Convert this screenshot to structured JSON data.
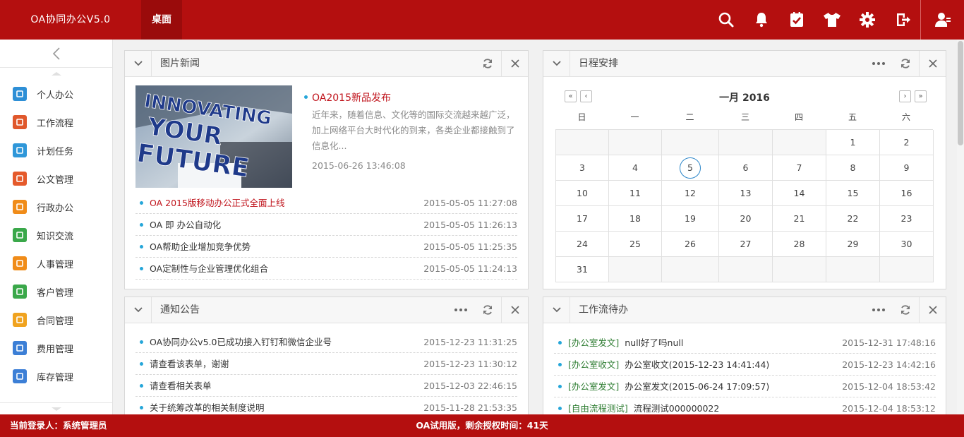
{
  "app": {
    "title": "OA协同办公V5.0",
    "tab": "桌面"
  },
  "top_icons": [
    "search-icon",
    "bell-icon",
    "task-check-icon",
    "shirt-icon",
    "gear-icon",
    "logout-icon"
  ],
  "user_icon": "user-icon",
  "colors": {
    "brand": "#b40f0f",
    "accent_red": "#c0141c",
    "dot_blue": "#25a6d9",
    "tag_green": "#2e7d32"
  },
  "sidebar": {
    "items": [
      {
        "label": "个人办公",
        "icon": "personal-icon",
        "color": "#2e8fd6"
      },
      {
        "label": "工作流程",
        "icon": "workflow-icon",
        "color": "#e0582c"
      },
      {
        "label": "计划任务",
        "icon": "plan-icon",
        "color": "#2f97d9"
      },
      {
        "label": "公文管理",
        "icon": "document-icon",
        "color": "#e55a2b"
      },
      {
        "label": "行政办公",
        "icon": "admin-icon",
        "color": "#f08c19"
      },
      {
        "label": "知识交流",
        "icon": "knowledge-icon",
        "color": "#3aa84a"
      },
      {
        "label": "人事管理",
        "icon": "hr-icon",
        "color": "#f08c19"
      },
      {
        "label": "客户管理",
        "icon": "customer-icon",
        "color": "#3aa84a"
      },
      {
        "label": "合同管理",
        "icon": "contract-icon",
        "color": "#f0a31f"
      },
      {
        "label": "费用管理",
        "icon": "expense-icon",
        "color": "#3c7fd6"
      },
      {
        "label": "库存管理",
        "icon": "inventory-icon",
        "color": "#3c7fd6"
      }
    ]
  },
  "news": {
    "title": "图片新闻",
    "feature": {
      "title": "OA2015新品发布",
      "desc": "近年来，随着信息、文化等的国际交流越来越广泛，加上网络平台大时代化的到来，各类企业都接触到了信息化...",
      "time": "2015-06-26 13:46:08",
      "image_text": [
        "INNOVATING",
        "YOUR",
        "FUTURE"
      ]
    },
    "items": [
      {
        "text": "OA 2015版移动办公正式全面上线",
        "time": "2015-05-05 11:27:08",
        "highlight": true
      },
      {
        "text": "OA 即 办公自动化",
        "time": "2015-05-05 11:26:13",
        "highlight": false
      },
      {
        "text": "OA帮助企业增加竞争优势",
        "time": "2015-05-05 11:25:35",
        "highlight": false
      },
      {
        "text": "OA定制性与企业管理优化组合",
        "time": "2015-05-05 11:24:13",
        "highlight": false
      }
    ]
  },
  "schedule": {
    "title": "日程安排",
    "month_title": "一月 2016",
    "weekdays": [
      "日",
      "一",
      "二",
      "三",
      "四",
      "五",
      "六"
    ],
    "days": [
      "",
      "",
      "",
      "",
      "",
      "1",
      "2",
      "3",
      "4",
      "5",
      "6",
      "7",
      "8",
      "9",
      "10",
      "11",
      "12",
      "13",
      "14",
      "15",
      "16",
      "17",
      "18",
      "19",
      "20",
      "21",
      "22",
      "23",
      "24",
      "25",
      "26",
      "27",
      "28",
      "29",
      "30",
      "31",
      "",
      "",
      "",
      "",
      "",
      ""
    ],
    "today": "5"
  },
  "notice": {
    "title": "通知公告",
    "items": [
      {
        "text": "OA协同办公v5.0已成功接入钉钉和微信企业号",
        "time": "2015-12-23 11:31:25"
      },
      {
        "text": "请查看该表单，谢谢",
        "time": "2015-12-23 11:30:12"
      },
      {
        "text": "请查看相关表单",
        "time": "2015-12-03 22:46:15"
      },
      {
        "text": "关于统筹改革的相关制度说明",
        "time": "2015-11-28 21:53:35"
      }
    ]
  },
  "workflow": {
    "title": "工作流待办",
    "items": [
      {
        "tag": "[办公室发文]",
        "text": "null好了吗null",
        "time": "2015-12-31 17:48:16"
      },
      {
        "tag": "[办公室收文]",
        "text": "办公室收文(2015-12-23 14:41:44)",
        "time": "2015-12-23 14:42:16"
      },
      {
        "tag": "[办公室发文]",
        "text": "办公室发文(2015-06-24 17:09:57)",
        "time": "2015-12-04 18:53:42"
      },
      {
        "tag": "[自由流程测试]",
        "text": "流程测试000000022",
        "time": "2015-12-04 18:53:12"
      }
    ]
  },
  "status": {
    "login": "当前登录人：系统管理员",
    "license": "OA试用版，剩余授权时间：41天"
  }
}
